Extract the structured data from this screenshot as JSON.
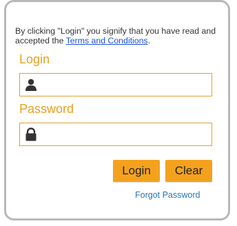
{
  "notice": {
    "prefix": "By clicking \"Login\" you signify that you have read and accepted the ",
    "terms_link": "Terms and Conditions",
    "suffix": "."
  },
  "login_field": {
    "label": "Login",
    "value": "",
    "icon": "user-icon"
  },
  "password_field": {
    "label": "Password",
    "value": "",
    "icon": "lock-icon"
  },
  "buttons": {
    "login_label": "Login",
    "clear_label": "Clear"
  },
  "forgot_password": "Forgot Password",
  "colors": {
    "accent": "#f4a21d",
    "label": "#e8a020",
    "link": "#1a4fd6",
    "secondary_link": "#2a75b8",
    "border": "#b8b8b8"
  }
}
